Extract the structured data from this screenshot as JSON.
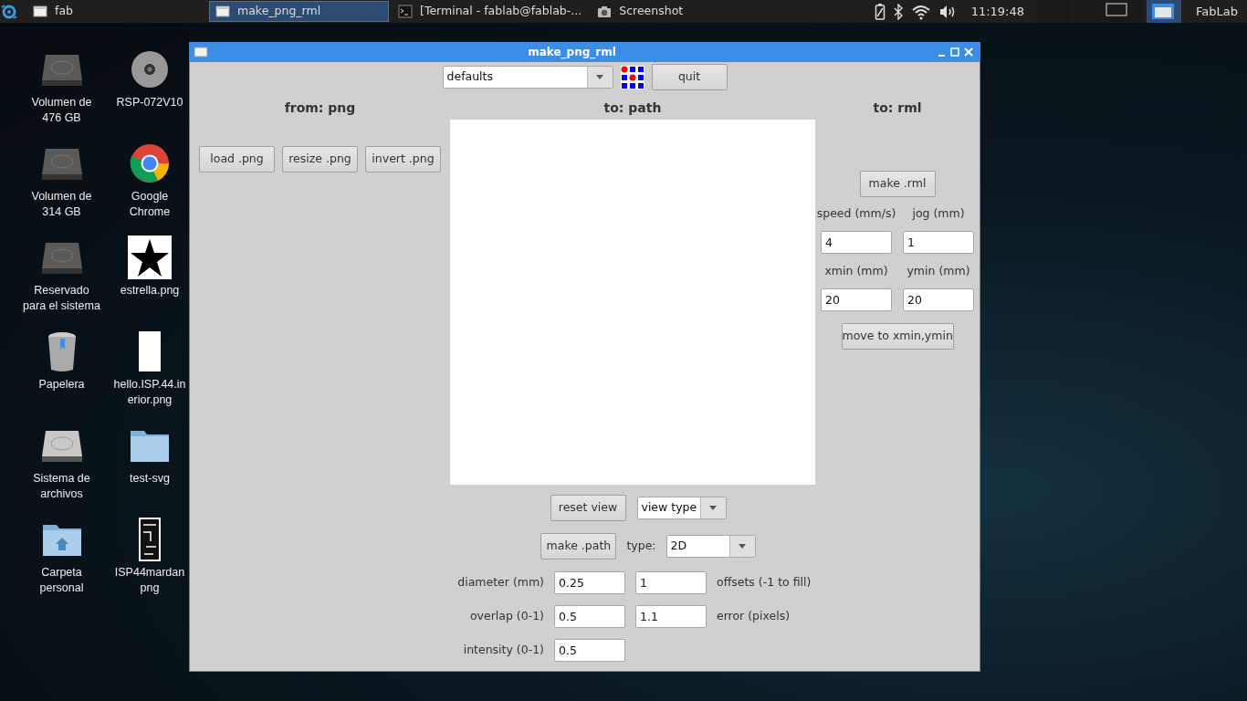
{
  "taskbar": {
    "tasks": [
      {
        "label": "fab",
        "kind": "window",
        "selected": false
      },
      {
        "label": "make_png_rml",
        "kind": "window",
        "selected": true
      },
      {
        "label": "[Terminal - fablab@fablab-...",
        "kind": "terminal",
        "selected": false
      },
      {
        "label": "Screenshot",
        "kind": "camera",
        "selected": false
      }
    ],
    "clock": "11:19:48",
    "user": "FabLab"
  },
  "desktop_icons": [
    {
      "kind": "drive",
      "lines": [
        "Volumen de",
        "476 GB"
      ]
    },
    {
      "kind": "disc",
      "lines": [
        "RSP-072V10"
      ]
    },
    {
      "kind": "drive",
      "lines": [
        "Volumen de",
        "314 GB"
      ]
    },
    {
      "kind": "browser",
      "lines": [
        "Google",
        "Chrome"
      ]
    },
    {
      "kind": "drive",
      "lines": [
        "Reservado",
        "para el sistema"
      ]
    },
    {
      "kind": "star-image",
      "lines": [
        "estrella.png"
      ]
    },
    {
      "kind": "trash",
      "lines": [
        "Papelera"
      ]
    },
    {
      "kind": "blank-image",
      "lines": [
        "hello.ISP.44.in",
        "erior.png"
      ]
    },
    {
      "kind": "system-drive",
      "lines": [
        "Sistema de",
        "archivos"
      ]
    },
    {
      "kind": "folder",
      "lines": [
        "test-svg"
      ]
    },
    {
      "kind": "home-folder",
      "lines": [
        "Carpeta",
        "personal"
      ]
    },
    {
      "kind": "board-image",
      "lines": [
        "ISP44mardan",
        "png"
      ]
    }
  ],
  "window": {
    "title": "make_png_rml",
    "preset": "defaults",
    "quit_button": "quit",
    "from_png": {
      "heading": "from: png",
      "buttons": [
        "load .png",
        "resize .png",
        "invert .png"
      ]
    },
    "to_path": {
      "heading": "to: path",
      "reset_button": "reset view",
      "view_dropdown": "view type",
      "make_button": "make .path",
      "type_label": "type:",
      "type_value": "2D",
      "params": [
        {
          "label": "diameter (mm)",
          "value": "0.25",
          "value_2": "1",
          "label_2": "offsets (-1 to fill)"
        },
        {
          "label": "overlap (0-1)",
          "value": "0.5",
          "value_2": "1.1",
          "label_2": "error (pixels)"
        },
        {
          "label": "intensity (0-1)",
          "value": "0.5"
        }
      ]
    },
    "to_rml": {
      "heading": "to: rml",
      "make_button": "make .rml",
      "fields": [
        {
          "label": "speed (mm/s)",
          "value": "4"
        },
        {
          "label": "jog (mm)",
          "value": "1"
        },
        {
          "label": "xmin (mm)",
          "value": "20"
        },
        {
          "label": "ymin (mm)",
          "value": "20"
        }
      ],
      "move_button": "move to xmin,ymin"
    }
  }
}
